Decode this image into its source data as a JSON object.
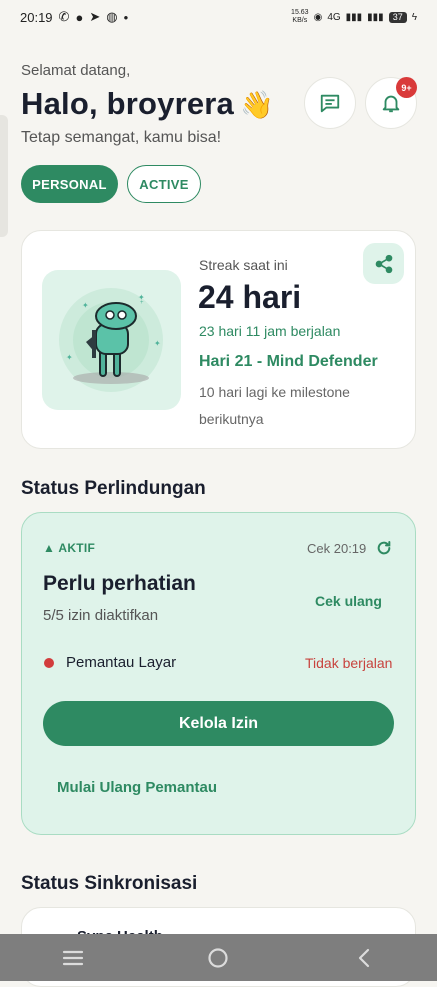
{
  "status_bar": {
    "time": "20:19",
    "net_speed_value": "15.63",
    "net_speed_unit": "KB/s",
    "network": "4G",
    "battery": "37"
  },
  "header": {
    "welcome": "Selamat datang,",
    "greeting": "Halo, broyrera",
    "wave_emoji": "👋",
    "subtitle": "Tetap semangat, kamu bisa!",
    "notification_badge": "9+"
  },
  "mode_tabs": {
    "personal": "PERSONAL",
    "active": "ACTIVE"
  },
  "streak": {
    "label": "Streak saat ini",
    "value": "24 hari",
    "elapsed": "23 hari 11 jam berjalan",
    "milestone": "Hari 21 - Mind Defender",
    "next_milestone": "10 hari lagi ke milestone berikutnya"
  },
  "protection": {
    "section_title": "Status Perlindungan",
    "status": "▲ AKTIF",
    "checked": "Cek 20:19",
    "title": "Perlu perhatian",
    "permissions": "5/5 izin diaktifkan",
    "recheck_label": "Cek ulang",
    "monitor_name": "Pemantau Layar",
    "monitor_status": "Tidak berjalan",
    "manage_button": "Kelola Izin",
    "restart_button": "Mulai Ulang Pemantau"
  },
  "sync": {
    "section_title": "Status Sinkronisasi",
    "first_item_peek": "Sync Health"
  },
  "colors": {
    "accent": "#2e8a62",
    "accent_light": "#dff3ea",
    "danger": "#d23c3c",
    "background": "#f6f5f1"
  },
  "icons": {
    "message": "message-square-icon",
    "bell": "bell-icon",
    "share": "share-icon",
    "refresh": "refresh-icon"
  }
}
